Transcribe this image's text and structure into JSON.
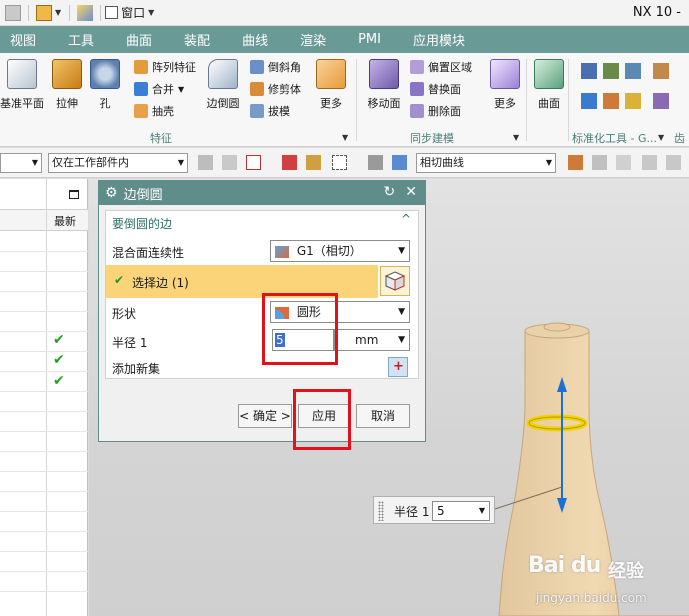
{
  "app": {
    "title": "NX 10 -",
    "window_menu_label": "窗口"
  },
  "menubar": {
    "items": [
      "视图",
      "工具",
      "曲面",
      "装配",
      "曲线",
      "渲染",
      "PMI",
      "应用模块"
    ]
  },
  "ribbon": {
    "buttons": {
      "datum_plane": "基准平面",
      "extrude": "拉伸",
      "hole": "孔",
      "pattern_feature": "阵列特征",
      "unite": "合并",
      "shell": "抽壳",
      "edge_blend": "边倒圆",
      "chamfer": "倒斜角",
      "trim_body": "修剪体",
      "draft": "拔模",
      "more_feature": "更多",
      "move_face": "移动面",
      "offset_region": "偏置区域",
      "replace_face": "替换面",
      "delete_face": "删除面",
      "more_sync": "更多",
      "surface": "曲面"
    },
    "groups": {
      "feature": "特征",
      "sync_modeling": "同步建模",
      "std_tools": "标准化工具 - G...",
      "gear": "齿"
    }
  },
  "toolbar2": {
    "filter_combo": "仅在工作部件内",
    "curve_rule_combo": "相切曲线"
  },
  "left_panel": {
    "column_latest": "最新"
  },
  "dialog": {
    "title": "边倒圆",
    "section_title": "要倒圆的边",
    "continuity_label": "混合面连续性",
    "continuity_value": "G1（相切）",
    "select_edge_label": "选择边 (1)",
    "shape_label": "形状",
    "shape_value": "圆形",
    "radius_label": "半径 1",
    "radius_value": "5",
    "unit_value": "mm",
    "add_new_set_label": "添加新集",
    "ok_label": "< 确定 >",
    "apply_label": "应用",
    "cancel_label": "取消"
  },
  "float_input": {
    "label": "半径 1",
    "value": "5"
  },
  "watermark": {
    "logo": "Bai du",
    "jingyan": "经验",
    "url": "jingyan.baidu.com"
  },
  "colors": {
    "menubar_bg": "#6a9a96",
    "dialog_title_bg": "#5f8e8a",
    "selected_row_bg": "#fbd47a",
    "highlight_red": "#e0121a",
    "ring_yellow": "#f2d300",
    "arrow_blue": "#1a6fd6"
  },
  "icons": [
    "ribbon-datum-plane-icon",
    "extrude-icon",
    "hole-icon",
    "edge-blend-icon",
    "move-face-icon",
    "surface-icon",
    "refresh-icon",
    "close-icon",
    "check-icon",
    "gear-icon",
    "cube-icon"
  ]
}
